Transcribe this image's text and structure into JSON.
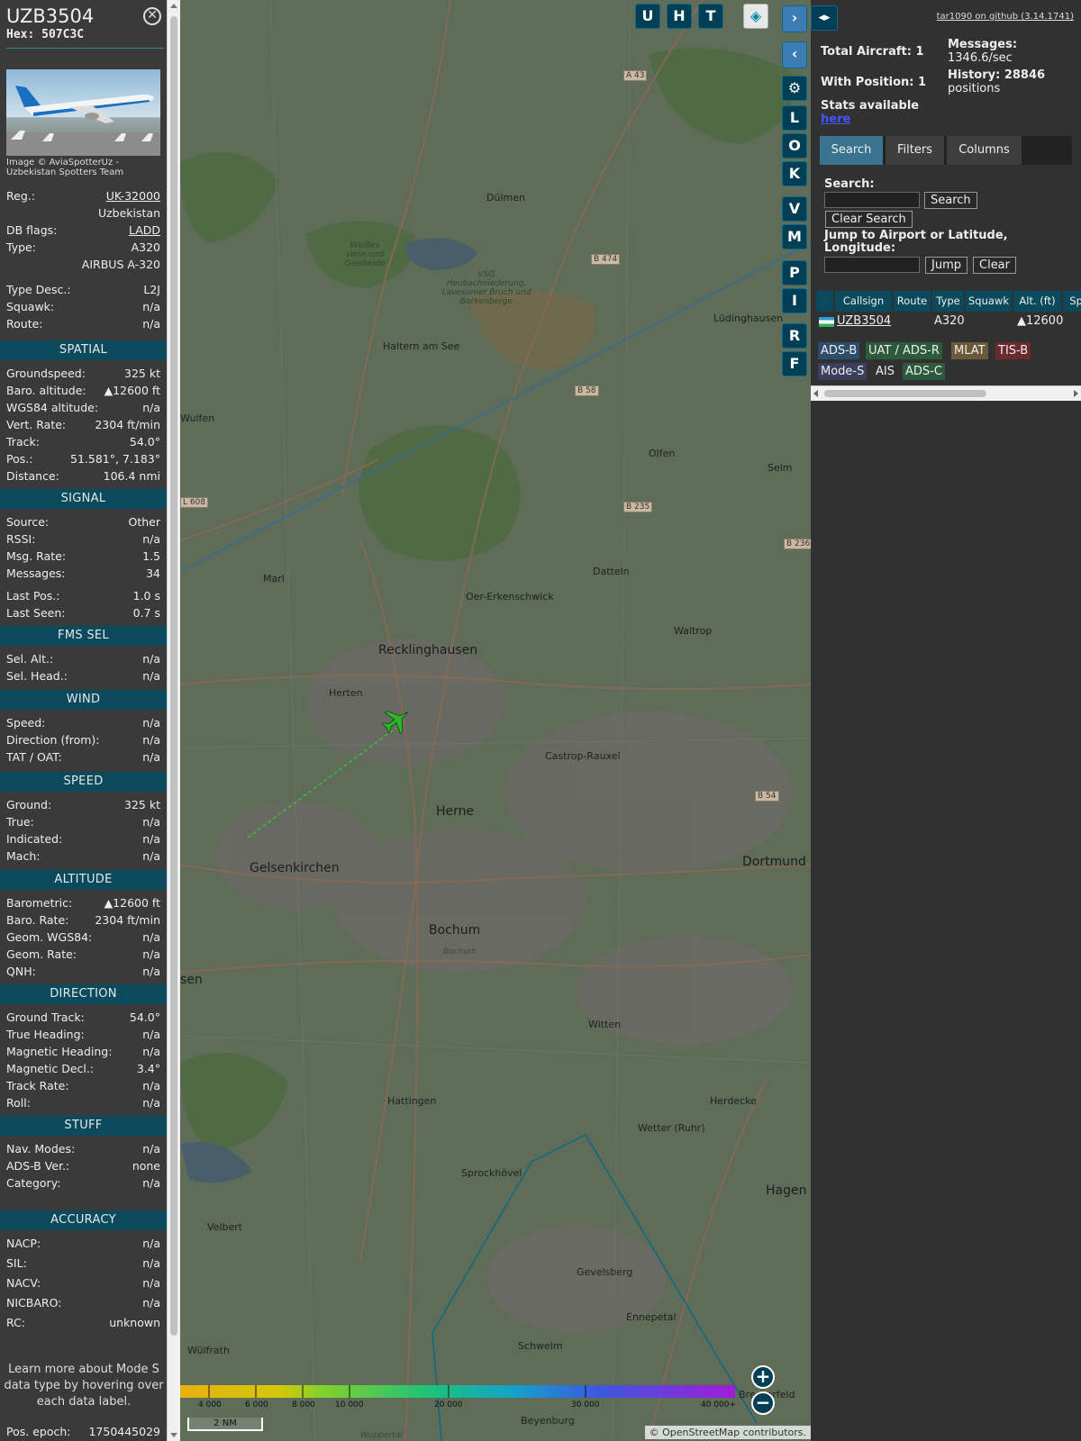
{
  "aircraft": {
    "callsign": "UZB3504",
    "hex": "Hex: 507C3C",
    "photo_credit": "Image © AviaSpotterUz - Uzbekistan Spotters Team"
  },
  "info": {
    "reg_label": "Reg.:",
    "reg": "UK-32000",
    "country": "Uzbekistan",
    "dbflags_label": "DB flags:",
    "dbflags": "LADD",
    "type_label": "Type:",
    "type": "A320",
    "type_name": "AIRBUS A-320",
    "typedesc_label": "Type Desc.:",
    "typedesc": "L2J",
    "squawk_label": "Squawk:",
    "squawk": "n/a",
    "route_label": "Route:",
    "route": "n/a"
  },
  "sections": {
    "spatial": "SPATIAL",
    "signal": "SIGNAL",
    "fms": "FMS SEL",
    "wind": "WIND",
    "speed": "SPEED",
    "altitude": "ALTITUDE",
    "direction": "DIRECTION",
    "stuff": "STUFF",
    "accuracy": "ACCURACY"
  },
  "spatial": [
    {
      "label": "Groundspeed:",
      "value": "325 kt"
    },
    {
      "label": "Baro. altitude:",
      "value": "▲12600 ft"
    },
    {
      "label": "WGS84 altitude:",
      "value": "n/a"
    },
    {
      "label": "Vert. Rate:",
      "value": "2304 ft/min"
    },
    {
      "label": "Track:",
      "value": "54.0°"
    },
    {
      "label": "Pos.:",
      "value": "51.581°, 7.183°"
    },
    {
      "label": "Distance:",
      "value": "106.4 nmi"
    }
  ],
  "signal": [
    {
      "label": "Source:",
      "value": "Other"
    },
    {
      "label": "RSSI:",
      "value": "n/a"
    },
    {
      "label": "Msg. Rate:",
      "value": "1.5"
    },
    {
      "label": "Messages:",
      "value": "34"
    },
    {
      "label": "Last Pos.:",
      "value": "1.0 s"
    },
    {
      "label": "Last Seen:",
      "value": "0.7 s"
    }
  ],
  "fms": [
    {
      "label": "Sel. Alt.:",
      "value": "n/a"
    },
    {
      "label": "Sel. Head.:",
      "value": "n/a"
    }
  ],
  "wind": [
    {
      "label": "Speed:",
      "value": "n/a"
    },
    {
      "label": "Direction (from):",
      "value": "n/a"
    },
    {
      "label": "TAT / OAT:",
      "value": "n/a"
    }
  ],
  "speed": [
    {
      "label": "Ground:",
      "value": "325 kt"
    },
    {
      "label": "True:",
      "value": "n/a"
    },
    {
      "label": "Indicated:",
      "value": "n/a"
    },
    {
      "label": "Mach:",
      "value": "n/a"
    }
  ],
  "altitude": [
    {
      "label": "Barometric:",
      "value": "▲12600 ft"
    },
    {
      "label": "Baro. Rate:",
      "value": "2304 ft/min"
    },
    {
      "label": "Geom. WGS84:",
      "value": "n/a"
    },
    {
      "label": "Geom. Rate:",
      "value": "n/a"
    },
    {
      "label": "QNH:",
      "value": "n/a"
    }
  ],
  "direction": [
    {
      "label": "Ground Track:",
      "value": "54.0°"
    },
    {
      "label": "True Heading:",
      "value": "n/a"
    },
    {
      "label": "Magnetic Heading:",
      "value": "n/a"
    },
    {
      "label": "Magnetic Decl.:",
      "value": "3.4°"
    },
    {
      "label": "Track Rate:",
      "value": "n/a"
    },
    {
      "label": "Roll:",
      "value": "n/a"
    }
  ],
  "stuff": [
    {
      "label": "Nav. Modes:",
      "value": "n/a"
    },
    {
      "label": "ADS-B Ver.:",
      "value": "none"
    },
    {
      "label": "Category:",
      "value": "n/a"
    }
  ],
  "accuracy": [
    {
      "label": "NACP:",
      "value": "n/a"
    },
    {
      "label": "SIL:",
      "value": "n/a"
    },
    {
      "label": "NACV:",
      "value": "n/a"
    },
    {
      "label": "NICBARO:",
      "value": "n/a"
    },
    {
      "label": "RC:",
      "value": "unknown"
    }
  ],
  "learn_more": "Learn more about Mode S data type by hovering over each data label.",
  "pos_epoch_label": "Pos. epoch:",
  "pos_epoch": "1750445029",
  "map": {
    "buttons": [
      "U",
      "H",
      "T",
      "L",
      "O",
      "K",
      "V",
      "M",
      "P",
      "I",
      "R",
      "F"
    ],
    "zoom_in": "+",
    "zoom_out": "−",
    "scale": "2 NM",
    "attribution": "© OpenStreetMap contributors.",
    "legend_ticks": [
      "4 000",
      "6 000",
      "8 000",
      "10 000",
      "20 000",
      "30 000",
      "40 000+"
    ],
    "places": {
      "dulmen": "Dülmen",
      "haltern": "Haltern am See",
      "olfen": "Olfen",
      "selm": "Selm",
      "luding": "Lüdinghausen",
      "wulfen": "Wulfen",
      "marl": "Marl",
      "oer": "Oer-Erkenschwick",
      "datteln": "Datteln",
      "waltrop": "Waltrop",
      "reckling": "Recklinghausen",
      "herten": "Herten",
      "castrop": "Castrop-Rauxel",
      "herne": "Herne",
      "gelsen": "Gelsenkirchen",
      "dortmund": "Dortmund",
      "bochum": "Bochum",
      "bochum2": "Bochum",
      "witten": "Witten",
      "essen": "sen",
      "hattingen": "Hattingen",
      "wetter": "Wetter (Ruhr)",
      "herdecke": "Herdecke",
      "sprock": "Sprockhövel",
      "hagen": "Hagen",
      "velbert": "Velbert",
      "gevelsberg": "Gevelsberg",
      "ennepetal": "Ennepetal",
      "schwelm": "Schwelm",
      "wulfrath": "Wülfrath",
      "beyenburg": "Beyenburg",
      "bkerfeld": "Breckerfeld",
      "wuppertal": "Wuppertal"
    },
    "roads": [
      "A 43",
      "B 474",
      "B 58",
      "B 235",
      "B 236",
      "L 608",
      "B 54"
    ],
    "green": {
      "weisses": "Weißes Venn und Geisheide",
      "vsg": "VSG Heubachniederung, Lavesumer Bruch und Borkenberge"
    }
  },
  "right": {
    "tar_link": "tar1090 on github (3.14.1741)",
    "total_aircraft": "Total Aircraft: 1",
    "with_position": "With Position: 1",
    "messages_label": "Messages:",
    "messages_value": "1346.6/sec",
    "history_label": "History: 28846",
    "history_value": "positions",
    "stats_label": "Stats available",
    "stats_link": "here",
    "tabs": [
      "Search",
      "Filters",
      "Columns"
    ],
    "search_label": "Search:",
    "search_btn": "Search",
    "clear_search_btn": "Clear Search",
    "jump_label": "Jump to Airport or Latitude, Longitude:",
    "jump_btn": "Jump",
    "clear_btn": "Clear",
    "columns": [
      "Callsign",
      "Route",
      "Type",
      "Squawk",
      "Alt. (ft)",
      "Sp"
    ],
    "row": {
      "callsign": "UZB3504",
      "route": "",
      "type": "A320",
      "squawk": "",
      "alt": "▲12600"
    },
    "tags": [
      "ADS-B",
      "UAT / ADS-R",
      "MLAT",
      "TIS-B",
      "Mode-S",
      "AIS",
      "ADS-C"
    ]
  }
}
